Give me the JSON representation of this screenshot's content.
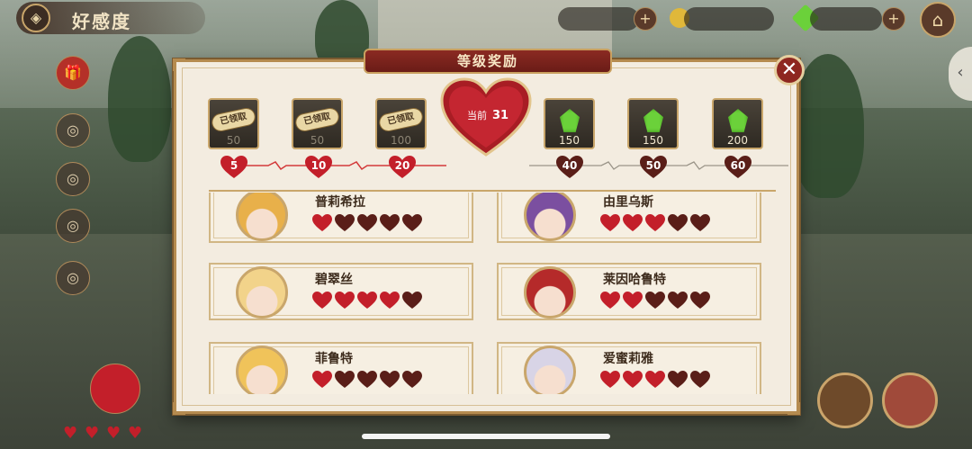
{
  "header": {
    "title": "好感度"
  },
  "modal": {
    "title": "等级奖励",
    "current_label": "当前",
    "current_value": "31"
  },
  "rewards": [
    {
      "type": "claimed",
      "label": "已领取",
      "amount": "50",
      "level": "5"
    },
    {
      "type": "claimed",
      "label": "已领取",
      "amount": "50",
      "level": "10"
    },
    {
      "type": "claimed",
      "label": "已领取",
      "amount": "100",
      "level": "20"
    },
    {
      "type": "gem",
      "label": "",
      "amount": "150",
      "level": "40"
    },
    {
      "type": "gem",
      "label": "",
      "amount": "150",
      "level": "50"
    },
    {
      "type": "gem",
      "label": "",
      "amount": "200",
      "level": "60"
    }
  ],
  "characters": [
    {
      "name": "普莉希拉",
      "hearts_filled": 1,
      "hearts_total": 5,
      "hair": "#e8b04a"
    },
    {
      "name": "由里乌斯",
      "hearts_filled": 3,
      "hearts_total": 5,
      "hair": "#7b4fa0"
    },
    {
      "name": "碧翠丝",
      "hearts_filled": 4,
      "hearts_total": 5,
      "hair": "#f2d38a"
    },
    {
      "name": "莱因哈鲁特",
      "hearts_filled": 2,
      "hearts_total": 5,
      "hair": "#b52a2a"
    },
    {
      "name": "菲鲁特",
      "hearts_filled": 1,
      "hearts_total": 5,
      "hair": "#f0c35a"
    },
    {
      "name": "爱蜜莉雅",
      "hearts_filled": 3,
      "hearts_total": 5,
      "hair": "#d8d4e6"
    }
  ],
  "colors": {
    "heart_filled": "#c31f2a",
    "heart_empty": "#5a1e18",
    "accent_gold": "#c9a66b",
    "header_red": "#8b2a22",
    "gem_green": "#6bd13a"
  }
}
